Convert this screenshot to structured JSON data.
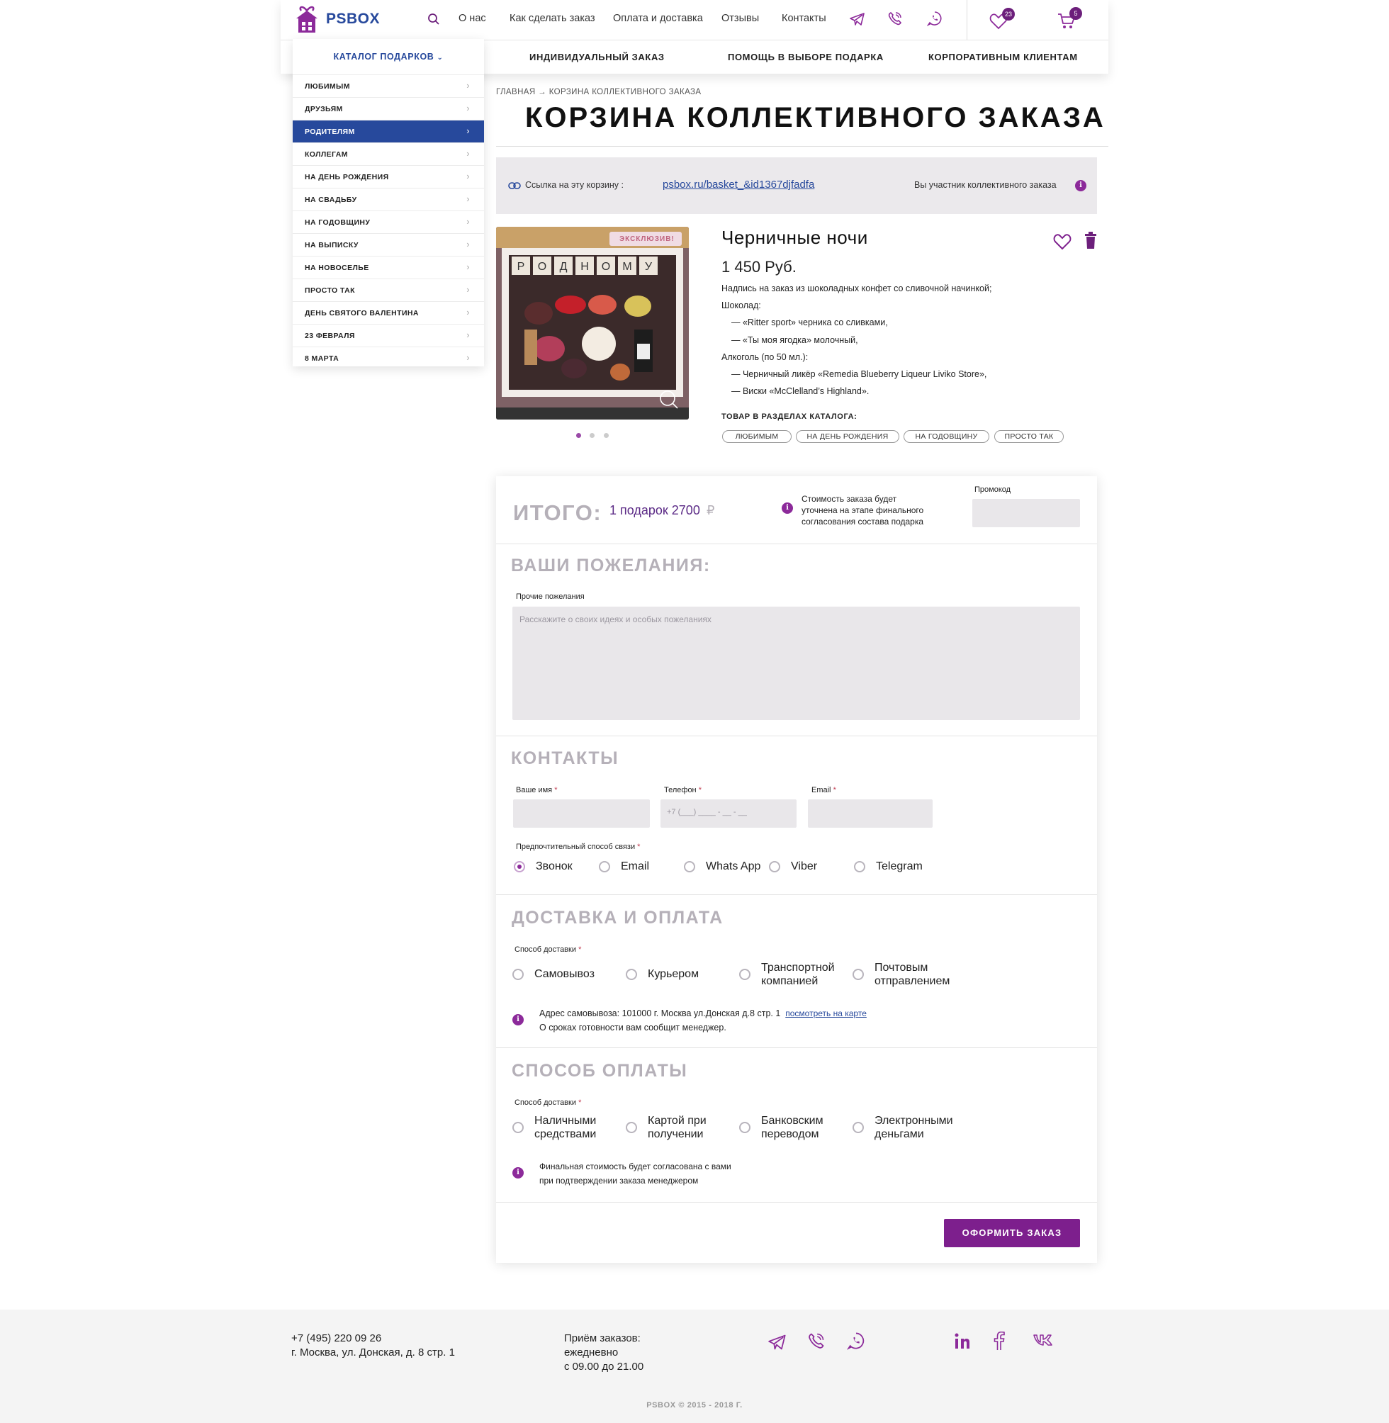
{
  "header": {
    "logo_text": "PSBOX",
    "nav": [
      "О нас",
      "Как сделать заказ",
      "Оплата и доставка",
      "Отзывы",
      "Контакты"
    ],
    "favorites_count": "23",
    "cart_count": "5",
    "subnav": [
      "ИНДИВИДУАЛЬНЫЙ ЗАКАЗ",
      "ПОМОЩЬ В ВЫБОРЕ ПОДАРКА",
      "КОРПОРАТИВНЫМ КЛИЕНТАМ"
    ]
  },
  "catalog": {
    "title": "КАТАЛОГ ПОДАРКОВ",
    "items": [
      "ЛЮБИМЫМ",
      "ДРУЗЬЯМ",
      "РОДИТЕЛЯМ",
      "КОЛЛЕГАМ",
      "НА ДЕНЬ РОЖДЕНИЯ",
      "НА СВАДЬБУ",
      "НА ГОДОВЩИНУ",
      "НА ВЫПИСКУ",
      "НА НОВОСЕЛЬЕ",
      "ПРОСТО ТАК",
      "ДЕНЬ СВЯТОГО ВАЛЕНТИНА",
      "23 ФЕВРАЛЯ",
      "8 МАРТА"
    ],
    "active_index": 2
  },
  "breadcrumb": {
    "home": "ГЛАВНАЯ",
    "arrow": "→",
    "current": "КОРЗИНА КОЛЛЕКТИВНОГО ЗАКАЗА"
  },
  "page_title": "КОРЗИНА КОЛЛЕКТИВНОГО ЗАКАЗА",
  "share": {
    "label": "Ссылка на эту корзину :",
    "url": "psbox.ru/basket_&id1367djfadfa",
    "participant": "Вы участник коллективного заказа"
  },
  "product": {
    "badge": "ЭКСКЛЮЗИВ!",
    "image_text": "РОДНОМУ",
    "name": "Черничные ночи",
    "price": "1 450 Руб.",
    "description": [
      "Надпись на заказ из шоколадных конфет со сливочной начинкой;",
      "Шоколад:",
      "— «Ritter sport» черника со сливками,",
      "— «Ты моя ягодка» молочный,",
      "Алкоголь (по 50 мл.):",
      "— Черничный ликёр «Remedia Blueberry Liqueur Liviko Store»,",
      "— Виски «McClelland’s Highland»."
    ],
    "tags_heading": "ТОВАР В РАЗДЕЛАХ КАТАЛОГА:",
    "tags": [
      "ЛЮБИМЫМ",
      "НА ДЕНЬ РОЖДЕНИЯ",
      "НА ГОДОВЩИНУ",
      "ПРОСТО ТАК"
    ]
  },
  "summary": {
    "total_label": "ИТОГО:",
    "total_value": "1 подарок 2700",
    "currency": "₽",
    "note": [
      "Стоимость заказа будет",
      "уточнена на этапе финального",
      "согласования состава подарка"
    ],
    "promo_label": "Промокод"
  },
  "wishes": {
    "title": "ВАШИ ПОЖЕЛАНИЯ:",
    "label": "Прочие пожелания",
    "placeholder": "Расскажите о своих идеях и особых пожеланиях"
  },
  "contacts": {
    "title": "КОНТАКТЫ",
    "name_label": "Ваше имя",
    "phone_label": "Телефон",
    "phone_placeholder": "+7 (___) ____ - __ - __",
    "email_label": "Email",
    "required": "*",
    "method_label": "Предпочтительный способ связи",
    "methods": [
      "Звонок",
      "Email",
      "Whats App",
      "Viber",
      "Telegram"
    ],
    "selected": "Звонок"
  },
  "delivery": {
    "title": "ДОСТАВКА И ОПЛАТА",
    "label": "Способ доставки",
    "options": [
      [
        "Самовывоз"
      ],
      [
        "Курьером"
      ],
      [
        "Транспортной",
        "компанией"
      ],
      [
        "Почтовым",
        "отправлением"
      ]
    ],
    "address_text": "Адрес самовывоза: 101000 г. Москва ул.Донская д.8 стр. 1",
    "map_link": "посмотреть на карте",
    "manager_note": "О сроках готовности вам сообщит менеджер."
  },
  "payment": {
    "title": "СПОСОБ ОПЛАТЫ",
    "label": "Способ доставки",
    "options": [
      [
        "Наличными",
        "средствами"
      ],
      [
        "Картой при",
        "получении"
      ],
      [
        "Банковским",
        "переводом"
      ],
      [
        "Электронными",
        "деньгами"
      ]
    ],
    "note": [
      "Финальная стоимость будет согласована с вами",
      "при подтверждении заказа менеджером"
    ]
  },
  "submit_label": "ОФОРМИТЬ ЗАКАЗ",
  "footer": {
    "phone": "+7 (495) 220 09 26",
    "address": "г. Москва, ул. Донская, д. 8 стр. 1",
    "hours": [
      "Приём заказов:",
      "ежедневно",
      "с 09.00 до 21.00"
    ],
    "copyright": "PSBOX © 2015 - 2018 Г."
  },
  "colors": {
    "brand_blue": "#27499c",
    "accent_purple": "#7d1f8d",
    "field_bg": "#e9e7ea"
  }
}
